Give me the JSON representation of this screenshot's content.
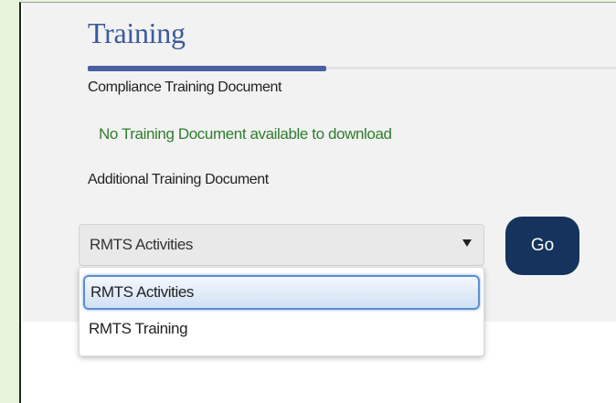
{
  "page": {
    "title": "Training",
    "compliance_label": "Compliance Training Document",
    "no_document_message": "No Training Document available to download",
    "additional_label": "Additional Training Document"
  },
  "select": {
    "value": "RMTS Activities",
    "options": [
      "RMTS Activities",
      "RMTS Training"
    ],
    "highlighted_index": 0
  },
  "go_button": {
    "label": "Go"
  },
  "colors": {
    "title": "#3b5a9a",
    "accent": "#4a5fa3",
    "message": "#2e7d2e",
    "button": "#15335c",
    "side_background": "#e8f3dc"
  }
}
